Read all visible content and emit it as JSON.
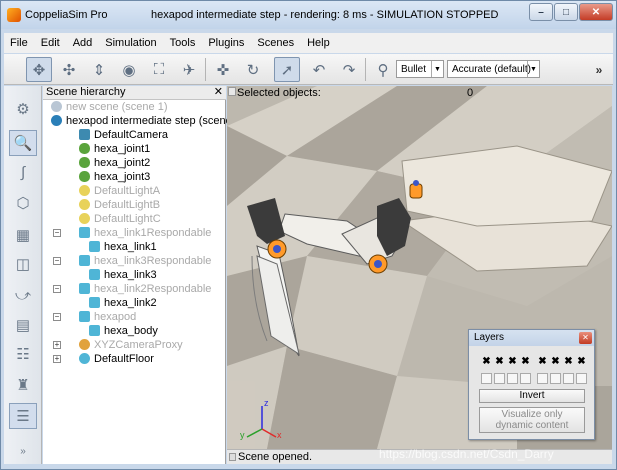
{
  "window": {
    "app_name": "CoppeliaSim Pro",
    "title": "hexapod intermediate step - rendering: 8 ms - SIMULATION STOPPED",
    "controls": {
      "minimize": "–",
      "maximize": "□",
      "close": "✕"
    }
  },
  "menu": [
    "File",
    "Edit",
    "Add",
    "Simulation",
    "Tools",
    "Plugins",
    "Scenes",
    "Help"
  ],
  "toolbar": {
    "engine": "Bullet",
    "accuracy": "Accurate (default)",
    "overflow": "»"
  },
  "scene_hierarchy": {
    "title": "Scene hierarchy",
    "close": "✕",
    "items": [
      {
        "label": "new scene (scene 1)",
        "icon": "globe-icon",
        "dim": true
      },
      {
        "label": "hexapod intermediate step (scene",
        "icon": "globe-icon",
        "dim": false
      },
      {
        "label": "DefaultCamera",
        "icon": "camera-icon",
        "dim": false
      },
      {
        "label": "hexa_joint1",
        "icon": "joint-icon",
        "dim": false
      },
      {
        "label": "hexa_joint2",
        "icon": "joint-icon",
        "dim": false
      },
      {
        "label": "hexa_joint3",
        "icon": "joint-icon",
        "dim": false
      },
      {
        "label": "DefaultLightA",
        "icon": "light-icon",
        "dim": true
      },
      {
        "label": "DefaultLightB",
        "icon": "light-icon",
        "dim": true
      },
      {
        "label": "DefaultLightC",
        "icon": "light-icon",
        "dim": true
      },
      {
        "label": "hexa_link1Respondable",
        "icon": "shape-icon",
        "dim": true
      },
      {
        "label": "hexa_link1",
        "icon": "shape-icon",
        "dim": false
      },
      {
        "label": "hexa_link3Respondable",
        "icon": "shape-icon",
        "dim": true
      },
      {
        "label": "hexa_link3",
        "icon": "shape-icon",
        "dim": false
      },
      {
        "label": "hexa_link2Respondable",
        "icon": "shape-icon",
        "dim": true
      },
      {
        "label": "hexa_link2",
        "icon": "shape-icon",
        "dim": false
      },
      {
        "label": "hexapod",
        "icon": "shape-icon",
        "dim": true
      },
      {
        "label": "hexa_body",
        "icon": "shape-icon",
        "dim": false
      },
      {
        "label": "XYZCameraProxy",
        "icon": "proxy-icon",
        "dim": true
      },
      {
        "label": "DefaultFloor",
        "icon": "floor-icon",
        "dim": false
      }
    ]
  },
  "viewport": {
    "selected_label": "Selected objects:",
    "selected_count": "0",
    "axis_x": "x",
    "axis_y": "y",
    "axis_z": "z"
  },
  "status": {
    "text": "Scene opened."
  },
  "layers_dialog": {
    "title": "Layers",
    "close": "✕",
    "checked_mark": "✖",
    "invert": "Invert",
    "dynamic_only_line1": "Visualize only",
    "dynamic_only_line2": "dynamic content"
  },
  "watermark": "https://blog.csdn.net/Csdn_Darry",
  "colors": {
    "titlebar": "#c8d8ec",
    "floor_light": "#d8d3c8",
    "floor_dark": "#a9a399",
    "robot_joint": "#ff9a2a",
    "robot_dark": "#3b3b3b"
  }
}
